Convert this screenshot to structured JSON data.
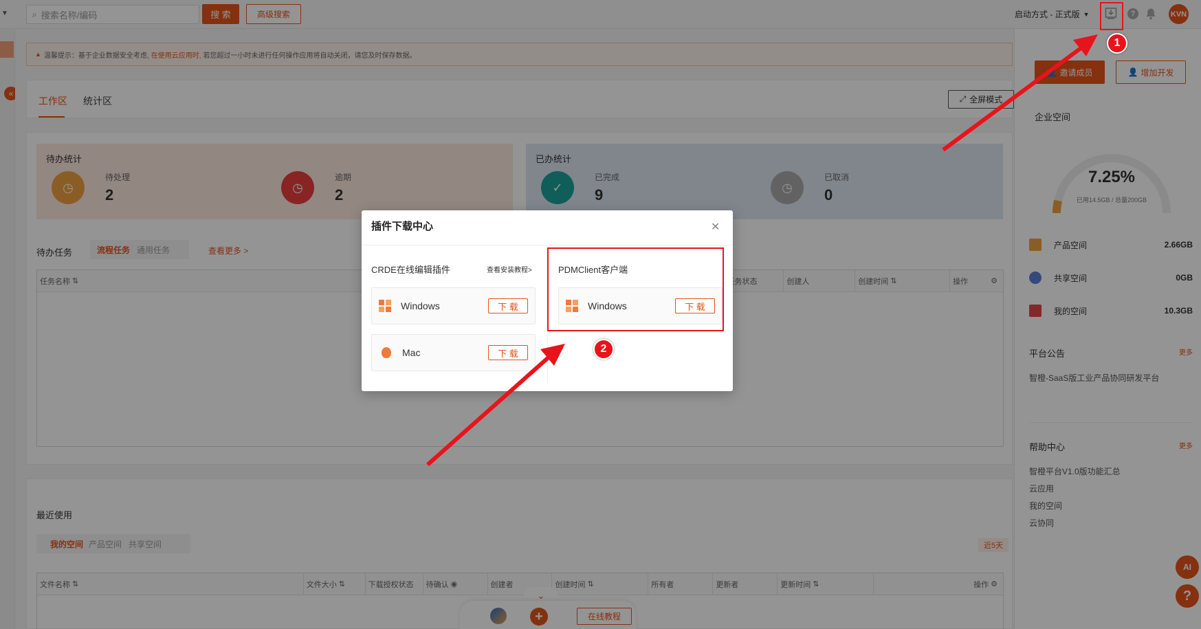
{
  "topbar": {
    "search_placeholder": "搜索名称/编码",
    "search_label": "搜 索",
    "advanced_search_label": "高级搜索",
    "launch_mode": "启动方式 - 正式版",
    "avatar_text": "KVN"
  },
  "notice": {
    "prefix": "温馨提示：基于企业数据安全考虑,",
    "highlight": "在使用云应用时,",
    "suffix": "若您超过一小时未进行任何操作应用将自动关闭，请您及时保存数据。"
  },
  "tabs": {
    "workspace": "工作区",
    "stats": "统计区",
    "fullscreen": "全屏模式"
  },
  "todo_stats": {
    "title": "待办统计",
    "pending_label": "待处理",
    "pending_value": "2",
    "overdue_label": "逾期",
    "overdue_value": "2"
  },
  "done_stats": {
    "title": "已办统计",
    "done_label": "已完成",
    "done_value": "9",
    "cancel_label": "已取消",
    "cancel_value": "0"
  },
  "tasks": {
    "title": "待办任务",
    "tab_flow": "流程任务",
    "tab_general": "通用任务",
    "more": "查看更多 >",
    "cols": [
      "任务名称",
      "任务状态",
      "创建人",
      "创建时间",
      "操作"
    ]
  },
  "recent": {
    "title": "最近使用",
    "tab_my": "我的空间",
    "tab_product": "产品空间",
    "tab_shared": "共享空间",
    "range": "近5天",
    "cols": [
      "文件名称",
      "文件大小",
      "下载授权状态",
      "待确认",
      "创建者",
      "创建时间",
      "所有者",
      "更新者",
      "更新时间",
      "操作"
    ]
  },
  "bottom_bar": {
    "tutorial": "在线教程"
  },
  "right_panel": {
    "invite": "邀请成员",
    "add_dev": "增加开发",
    "space_title": "企业空间",
    "percent": "7.25%",
    "usage_fraction": 0.0725,
    "usage": "已用14.5GB / 总量200GB",
    "spaces": [
      {
        "label": "产品空间",
        "value": "2.66GB"
      },
      {
        "label": "共享空间",
        "value": "0GB"
      },
      {
        "label": "我的空间",
        "value": "10.3GB"
      }
    ],
    "notice_title": "平台公告",
    "notice_more": "更多",
    "notice_item": "智橙-SaaS版工业产品协同研发平台",
    "help_title": "帮助中心",
    "help_more": "更多",
    "help_items": [
      "智橙平台V1.0版功能汇总",
      "云应用",
      "我的空间",
      "云协同"
    ]
  },
  "modal": {
    "title": "插件下载中心",
    "left_title": "CRDE在线编辑插件",
    "install_link": "查看安装教程>",
    "right_title": "PDMClient客户端",
    "windows": "Windows",
    "mac": "Mac",
    "download": "下 载"
  },
  "annotations": {
    "step1": "1",
    "step2": "2"
  },
  "colors": {
    "brand": "#e5531b",
    "annotation_red": "#e8141b"
  }
}
